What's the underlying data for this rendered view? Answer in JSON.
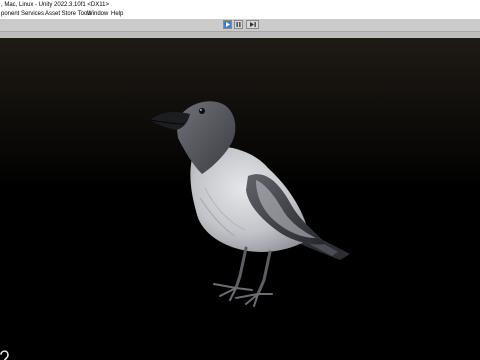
{
  "window": {
    "title": ", Mac, Linux - Unity 2022.3.10f1 <DX11>"
  },
  "menu": {
    "items": [
      "ponent",
      "Services",
      "Asset Store Tools",
      "Window",
      "Help"
    ]
  },
  "toolbar": {
    "play_icon": "play-icon",
    "pause_icon": "pause-icon",
    "step_icon": "step-icon"
  },
  "scene": {
    "subject": "crow-model",
    "colors": {
      "background_top": "#1e1a14",
      "background_bottom": "#000000",
      "feather_light": "#d9dadd",
      "feather_dark": "#2b2d33"
    }
  }
}
